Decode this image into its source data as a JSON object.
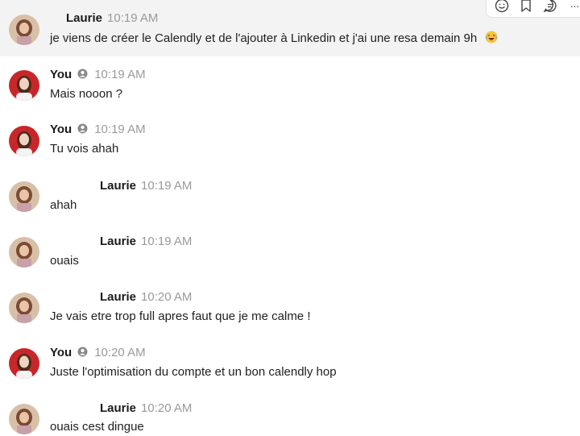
{
  "messages": [
    {
      "sender": "Laurie",
      "redacted": true,
      "time": "10:19 AM",
      "text": "je viens de créer le Calendly et de l'ajouter à Linkedin et j'ai une resa demain 9h",
      "emoji": "laughing-face"
    },
    {
      "sender": "You",
      "self": true,
      "time": "10:19 AM",
      "text": "Mais nooon ?"
    },
    {
      "sender": "You",
      "self": true,
      "time": "10:19 AM",
      "text": "Tu vois ahah"
    },
    {
      "sender": "Laurie",
      "redacted": true,
      "time": "10:19 AM",
      "text": "ahah"
    },
    {
      "sender": "Laurie",
      "redacted": true,
      "time": "10:19 AM",
      "text": "ouais"
    },
    {
      "sender": "Laurie",
      "redacted": true,
      "time": "10:20 AM",
      "text": "Je vais etre trop full apres faut que je me calme !"
    },
    {
      "sender": "You",
      "self": true,
      "time": "10:20 AM",
      "text": "Juste l'optimisation du compte et un  bon calendly hop"
    },
    {
      "sender": "Laurie",
      "redacted": true,
      "time": "10:20 AM",
      "text": "ouais cest dingue"
    }
  ],
  "toolbar": {
    "buttons": [
      "smiley-icon",
      "bookmark-icon",
      "reply-thread-icon",
      "more-icon"
    ],
    "more_label": "···"
  }
}
